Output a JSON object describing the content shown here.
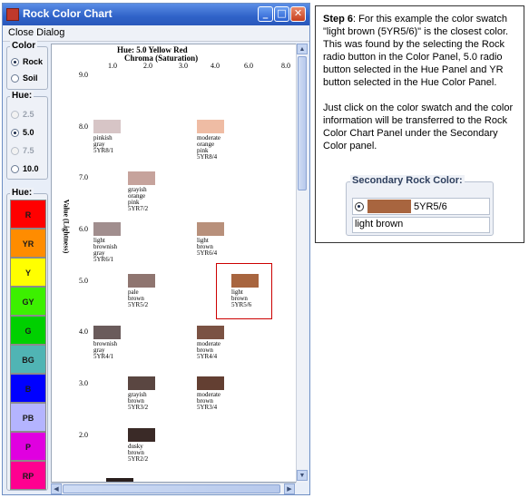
{
  "window": {
    "title": "Rock Color Chart",
    "buttons": {
      "minimize": "_",
      "maximize": "□",
      "close": "✕"
    }
  },
  "menu": {
    "close_dialog": "Close Dialog"
  },
  "color_panel": {
    "legend": "Color",
    "options": [
      {
        "label": "Rock",
        "selected": true
      },
      {
        "label": "Soil",
        "selected": false
      }
    ]
  },
  "hue_panel": {
    "legend": "Hue:",
    "options": [
      {
        "label": "2.5",
        "selected": false,
        "enabled": false
      },
      {
        "label": "5.0",
        "selected": true,
        "enabled": true
      },
      {
        "label": "7.5",
        "selected": false,
        "enabled": false
      },
      {
        "label": "10.0",
        "selected": false,
        "enabled": true
      }
    ]
  },
  "hue_color_panel": {
    "legend": "Hue:",
    "buttons": [
      {
        "label": "R",
        "color": "#ff0000"
      },
      {
        "label": "YR",
        "color": "#ff8c00"
      },
      {
        "label": "Y",
        "color": "#ffff00"
      },
      {
        "label": "GY",
        "color": "#3cf000"
      },
      {
        "label": "G",
        "color": "#00d000"
      },
      {
        "label": "BG",
        "color": "#50b4b4"
      },
      {
        "label": "B",
        "color": "#0000ff"
      },
      {
        "label": "PB",
        "color": "#b4b4ff"
      },
      {
        "label": "P",
        "color": "#e000e0"
      },
      {
        "label": "RP",
        "color": "#ff0090"
      }
    ]
  },
  "chart": {
    "title": "Hue: 5.0 Yellow Red",
    "chroma_label": "Chroma (Saturation)",
    "chroma_ticks": [
      "1.0",
      "2.0",
      "3.0",
      "4.0",
      "6.0",
      "8.0"
    ],
    "value_axis_label": "Value (Lightness)",
    "value_ticks": [
      "9.0",
      "8.0",
      "7.0",
      "6.0",
      "5.0",
      "4.0",
      "3.0",
      "2.0"
    ],
    "swatches": [
      {
        "name": "pinkish\ngray\n5YR8/1",
        "color": "#d7c5c6"
      },
      {
        "name": "moderate\norange\npink\n5YR8/4",
        "color": "#efbca4"
      },
      {
        "name": "grayish\norange\npink\n5YR7/2",
        "color": "#c6a39c"
      },
      {
        "name": "light\nbrownish\ngray\n5YR6/1",
        "color": "#a18e8e"
      },
      {
        "name": "light\nbrown\n5YR6/4",
        "color": "#b8907b"
      },
      {
        "name": "pale\nbrown\n5YR5/2",
        "color": "#8f7570"
      },
      {
        "name": "light\nbrown\n5YR5/6",
        "color": "#a8653f"
      },
      {
        "name": "brownish\ngray\n5YR4/1",
        "color": "#6a5b5b"
      },
      {
        "name": "moderate\nbrown\n5YR4/4",
        "color": "#7b5243"
      },
      {
        "name": "grayish\nbrown\n5YR3/2",
        "color": "#5a4641"
      },
      {
        "name": "moderate\nbrown\n5YR3/4",
        "color": "#633f32"
      },
      {
        "name": "dusky\nbrown\n5YR2/2",
        "color": "#3a2a27"
      }
    ],
    "highlight_color": "#cc0000"
  },
  "callout": {
    "step": "Step 6",
    "para1": ": For this example the color swatch \"light brown (5YR5/6)\" is the closest color. This was found by the selecting the Rock radio button in the Color Panel, 5.0 radio button selected in the Hue Panel and YR button selected in the Hue Color Panel.",
    "para2": "Just click on the color swatch and the color information will be transferred to the Rock Color Chart Panel under the Secondary Color panel."
  },
  "secondary": {
    "title": "Secondary Rock Color:",
    "code": "5YR5/6",
    "name": "light brown",
    "color": "#a8653f"
  }
}
